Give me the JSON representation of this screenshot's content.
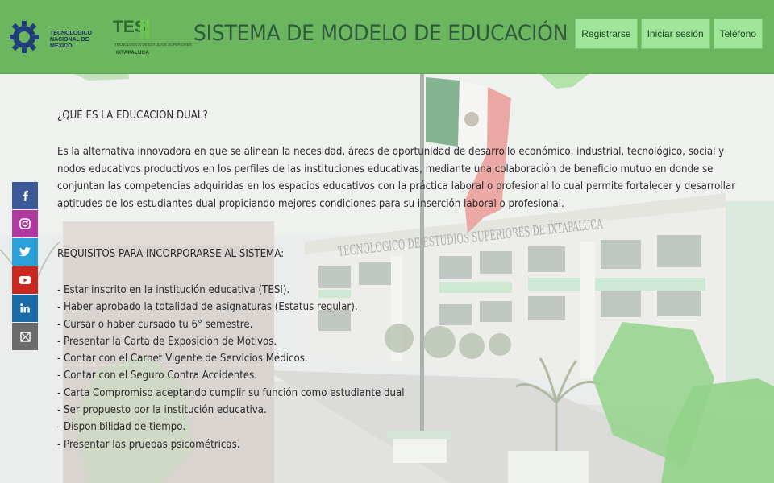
{
  "header": {
    "tecnm_logo_text": [
      "TECNOLOGICO",
      "NACIONAL DE MEXICO"
    ],
    "tesi_logo_mark": "TES",
    "tesi_logo_sub": "TECNOLOGICO DE ESTUDIOS SUPERIORES",
    "tesi_logo_city": "IXTAPALUCA",
    "title": "SISTEMA DE MODELO DE EDUCACIÓN DUAL",
    "nav": [
      "Registrarse",
      "Iniciar sesión",
      "Teléfono"
    ]
  },
  "building_sign": "TECNOLOGICO DE ESTUDIOS SUPERIORES DE IXTAPALUCA",
  "social": [
    {
      "icon": "facebook-icon",
      "glyph": "f",
      "color": "#3b5999"
    },
    {
      "icon": "instagram-icon",
      "glyph": "◎",
      "color": "#b03a9f"
    },
    {
      "icon": "twitter-icon",
      "glyph": "🐦",
      "color": "#2a9fd8"
    },
    {
      "icon": "youtube-icon",
      "glyph": "▶",
      "color": "#c8281f"
    },
    {
      "icon": "linkedin-icon",
      "glyph": "in",
      "color": "#1a6aa6"
    },
    {
      "icon": "mail-icon",
      "glyph": "✉",
      "color": "#6b6b6b"
    }
  ],
  "main": {
    "question": "¿QUÉ ES LA EDUCACIÓN DUAL?",
    "description": "Es la alternativa innovadora en que se alinean la necesidad, áreas de oportunidad de desarrollo económico, industrial, tecnológico, social y nodos educativos productivos en los perfiles de las instituciones educativas, mediante una colaboración de beneficio mutuo en donde se conjuntan las competencias adquiridas en los espacios educativos con la práctica laboral o profesional lo cual permite fortalecer y desarrollar aptitudes de los estudiantes dual propiciando mejores condiciones para su inserción laboral o profesional.",
    "requirements_title": "REQUISITOS PARA INCORPORARSE AL SISTEMA:",
    "requirements": [
      "- Estar inscrito en la institución educativa (TESI).",
      "- Haber aprobado la totalidad de asignaturas (Estatus regular).",
      "- Cursar o haber cursado tu 6° semestre.",
      "- Presentar la Carta de Exposición de Motivos.",
      "- Contar con el Carnet Vigente de Servicios Médicos.",
      "- Contar con el Seguro Contra Accidentes.",
      "- Carta Compromiso aceptando cumplir su función como estudiante dual",
      "- Ser propuesto por la institución educativa.",
      "- Disponibilidad de tiempo.",
      "- Presentar las pruebas psicométricas."
    ]
  },
  "colors": {
    "header_bg": "#6bb65f",
    "nav_button_bg": "#9fe69a",
    "title_color": "#2f5b3c",
    "accent_green": "#74c86a"
  }
}
